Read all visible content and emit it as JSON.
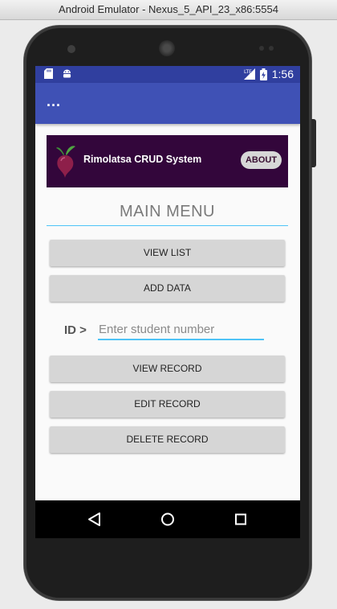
{
  "window": {
    "title": "Android Emulator - Nexus_5_API_23_x86:5554"
  },
  "status_bar": {
    "time": "1:56",
    "network": "LTE",
    "left_icons": [
      "sd-card-icon",
      "android-icon"
    ],
    "colors": {
      "bg": "#303f9f"
    }
  },
  "app_bar": {
    "overflow_label": "...",
    "color": "#3f51b5"
  },
  "banner": {
    "app_name": "Rimolatsa CRUD System",
    "about_label": "ABOUT",
    "bg": "#33063b"
  },
  "menu": {
    "title": "MAIN MENU",
    "view_list": "VIEW LIST",
    "add_data": "ADD DATA",
    "id_label": "ID >",
    "id_placeholder": "Enter student number",
    "view_record": "VIEW RECORD",
    "edit_record": "EDIT RECORD",
    "delete_record": "DELETE RECORD"
  },
  "nav": [
    "back-icon",
    "home-icon",
    "recents-icon"
  ]
}
